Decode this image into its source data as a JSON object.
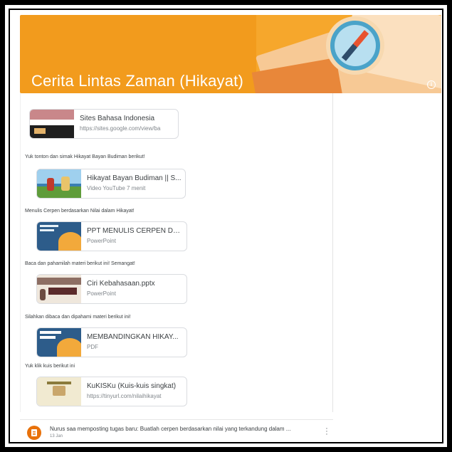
{
  "header": {
    "title": "Cerita Lintas Zaman (Hikayat)",
    "info_icon": "info-icon",
    "colors": {
      "banner": "#f29b1d",
      "accent": "#e8710a"
    }
  },
  "stream": {
    "items": [
      {
        "caption": "",
        "name": "Sites Bahasa Indonesia",
        "sub": "https://sites.google.com/view/ba"
      },
      {
        "caption": "Yuk tonton dan simak Hikayat Bayan Budiman berikut!",
        "name": "Hikayat Bayan Budiman || S...",
        "sub": "Video YouTube   7 menit"
      },
      {
        "caption": "Menulis Cerpen berdasarkan Nilai dalam Hikayat!",
        "name": "PPT MENULIS CERPEN DG ...",
        "sub": "PowerPoint"
      },
      {
        "caption": "Baca dan pahamilah materi berikut ini! Semangat!",
        "name": "Ciri Kebahasaan.pptx",
        "sub": "PowerPoint"
      },
      {
        "caption": "Silahkan dibaca dan dipahami materi berikut ini!",
        "name": "MEMBANDINGKAN HIKAY...",
        "sub": "PDF"
      },
      {
        "caption": "Yuk klik kuis berikut ini",
        "name": "KuKISKu (Kuis-kuis singkat)",
        "sub": "https://tinyurl.com/nilaihikayat"
      }
    ]
  },
  "post": {
    "text": "Nurus saa memposting tugas baru: Buatlah cerpen berdasarkan nilai yang terkandung dalam ...",
    "date": "13 Jan",
    "icon": "assignment-icon",
    "more_icon": "more-vert-icon"
  }
}
